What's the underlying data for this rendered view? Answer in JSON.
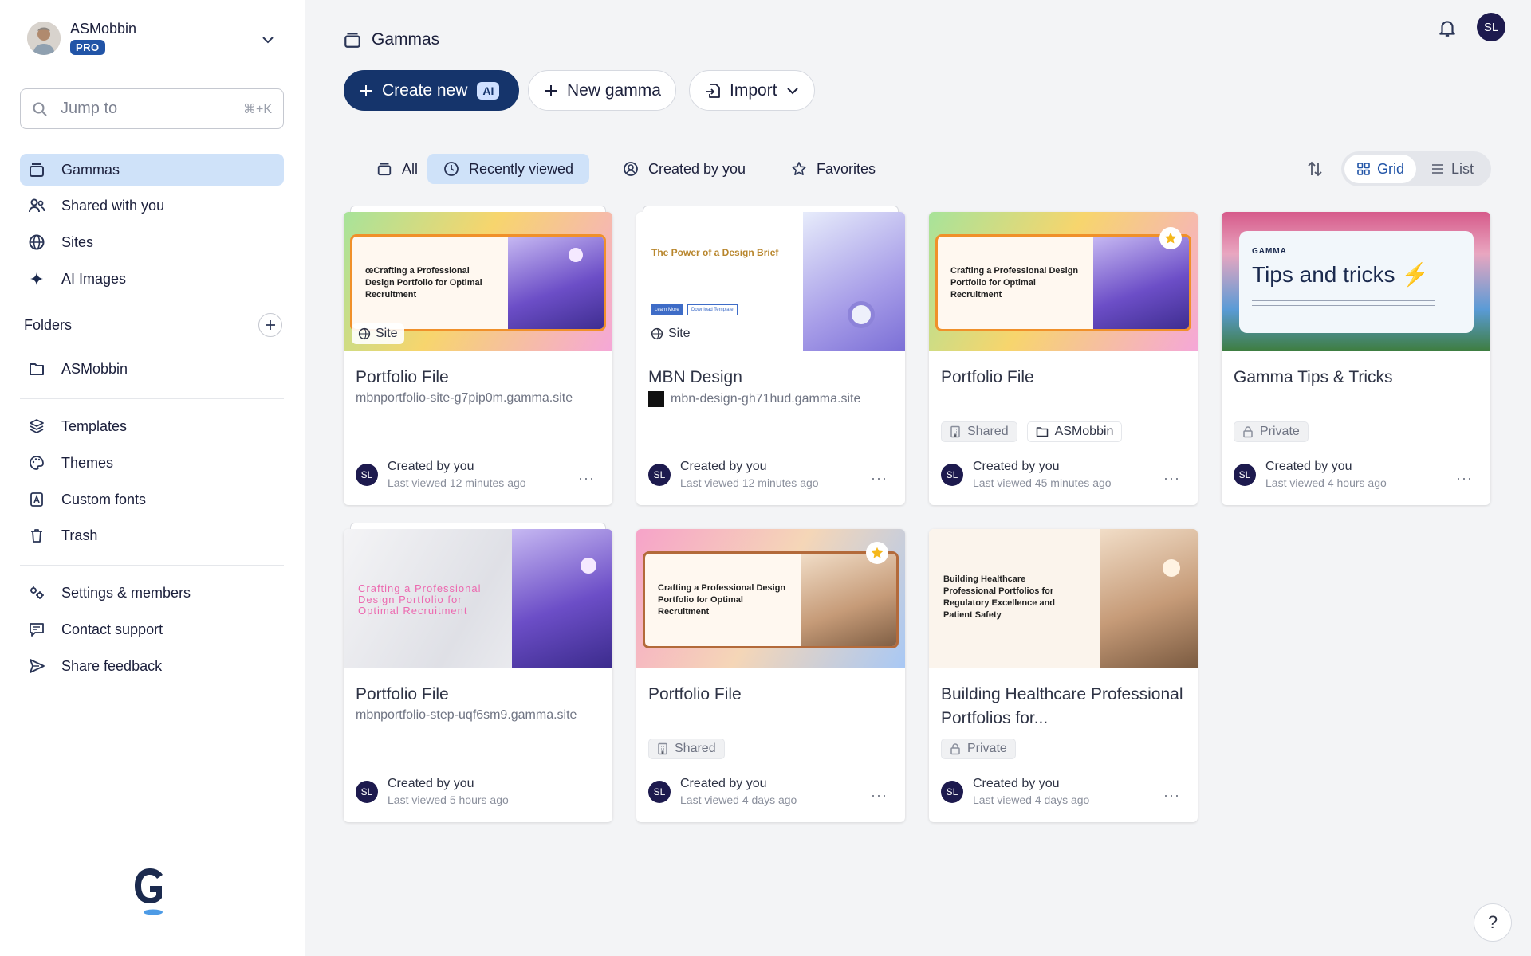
{
  "user": {
    "name": "ASMobbin",
    "plan": "PRO",
    "initials": "SL"
  },
  "search": {
    "placeholder": "Jump to",
    "shortcut": "⌘+K"
  },
  "sidebar": {
    "primary": [
      {
        "label": "Gammas",
        "icon": "stack-icon",
        "active": true
      },
      {
        "label": "Shared with you",
        "icon": "people-icon"
      },
      {
        "label": "Sites",
        "icon": "globe-icon"
      },
      {
        "label": "AI Images",
        "icon": "sparkle-icon"
      }
    ],
    "folders_title": "Folders",
    "folders": [
      {
        "label": "ASMobbin",
        "icon": "folder-icon"
      }
    ],
    "secondary": [
      {
        "label": "Templates",
        "icon": "layers-icon"
      },
      {
        "label": "Themes",
        "icon": "palette-icon"
      },
      {
        "label": "Custom fonts",
        "icon": "font-icon"
      },
      {
        "label": "Trash",
        "icon": "trash-icon"
      }
    ],
    "tertiary": [
      {
        "label": "Settings & members",
        "icon": "settings-icon"
      },
      {
        "label": "Contact support",
        "icon": "chat-icon"
      },
      {
        "label": "Share feedback",
        "icon": "send-icon"
      }
    ]
  },
  "header": {
    "title": "Gammas"
  },
  "toolbar": {
    "create_label": "Create new",
    "ai_badge": "AI",
    "new_label": "New gamma",
    "import_label": "Import"
  },
  "tabs": [
    {
      "label": "All",
      "icon": "stack-icon"
    },
    {
      "label": "Recently viewed",
      "icon": "clock-icon",
      "active": true
    },
    {
      "label": "Created by you",
      "icon": "user-circle-icon"
    },
    {
      "label": "Favorites",
      "icon": "star-icon"
    }
  ],
  "view": {
    "grid_label": "Grid",
    "list_label": "List",
    "selected": "Grid"
  },
  "cards": [
    {
      "title": "Portfolio File",
      "subtitle": "mbnportfolio-site-g7pip0m.gamma.site",
      "site_badge": "Site",
      "thumb_text": "œCrafting a Professional Design Portfolio for Optimal Recruitment",
      "created": "Created by you",
      "viewed": "Last viewed 12 minutes ago"
    },
    {
      "title": "MBN Design",
      "subtitle": "mbn-design-gh71hud.gamma.site",
      "site_badge": "Site",
      "thumb_text": "The Power of a Design Brief",
      "thumb_btn1": "Learn More",
      "thumb_btn2": "Download Template",
      "created": "Created by you",
      "viewed": "Last viewed 12 minutes ago"
    },
    {
      "title": "Portfolio File",
      "chips": [
        "Shared",
        "ASMobbin"
      ],
      "favorite": true,
      "thumb_text": "Crafting a Professional Design Portfolio for Optimal Recruitment",
      "created": "Created by you",
      "viewed": "Last viewed 45 minutes ago"
    },
    {
      "title": "Gamma Tips & Tricks",
      "chips": [
        "Private"
      ],
      "thumb_brand": "GAMMA",
      "thumb_text": "Tips and tricks ⚡",
      "created": "Created by you",
      "viewed": "Last viewed 4 hours ago"
    },
    {
      "title": "Portfolio File",
      "subtitle": "mbnportfolio-step-uqf6sm9.gamma.site",
      "thumb_text": "Crafting a Professional Design Portfolio for Optimal Recruitment",
      "created": "Created by you",
      "viewed": "Last viewed 5 hours ago"
    },
    {
      "title": "Portfolio File",
      "chips": [
        "Shared"
      ],
      "favorite": true,
      "thumb_text": "Crafting a Professional Design Portfolio for Optimal Recruitment",
      "created": "Created by you",
      "viewed": "Last viewed 4 days ago"
    },
    {
      "title": "Building Healthcare Professional Portfolios for...",
      "chips": [
        "Private"
      ],
      "thumb_text": "Building Healthcare Professional Portfolios for Regulatory Excellence and Patient Safety",
      "created": "Created by you",
      "viewed": "Last viewed 4 days ago"
    }
  ],
  "colors": {
    "accent": "#15346b",
    "active_bg": "#cfe2f9",
    "avatar": "#1d1a4e",
    "pro": "#2154a7"
  }
}
